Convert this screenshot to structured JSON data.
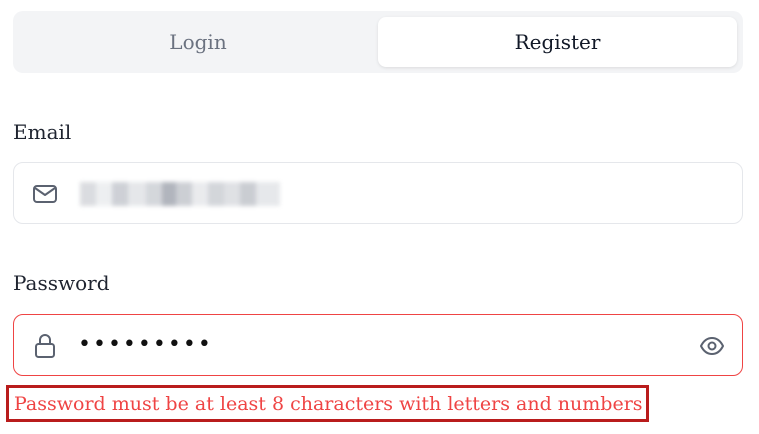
{
  "tabs": {
    "login_label": "Login",
    "register_label": "Register",
    "active": "register"
  },
  "email": {
    "label": "Email",
    "value": "",
    "icon": "mail-icon",
    "value_redacted": true
  },
  "password": {
    "label": "Password",
    "masked_value": "•••••••••",
    "icon": "lock-icon",
    "toggle_icon": "eye-icon",
    "error": "Password must be at least 8 characters with letters and numbers"
  },
  "colors": {
    "error": "#ef4444",
    "error_outline": "#b91c1c",
    "tab_bg": "#f3f4f6",
    "active_tab_bg": "#ffffff",
    "input_border": "#e5e7eb",
    "muted_text": "#6b7280"
  }
}
